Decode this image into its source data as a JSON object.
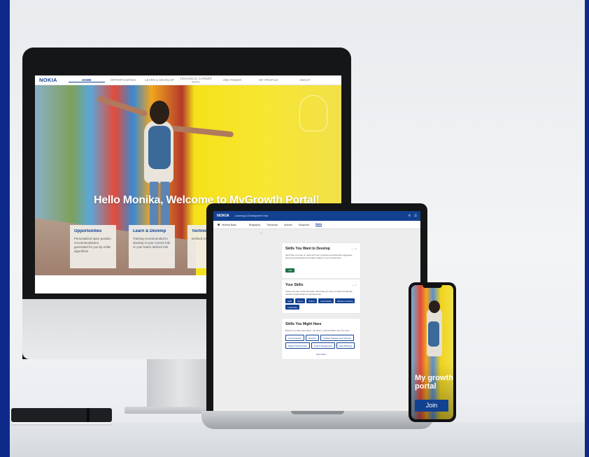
{
  "colors": {
    "frame": "#0d2a8a",
    "brand": "#124191",
    "accent_yellow": "#f5e11a"
  },
  "monitor": {
    "logo": "NOKIA",
    "nav": [
      "HOME",
      "OPPORTUNITIES",
      "LEARN & DEVELOP",
      "TECHNICAL CAREER PATH",
      "JOB FINDER",
      "MY PROFILE",
      "ABOUT"
    ],
    "headline": "Hello Monika, Welcome to MyGrowth Portal!",
    "cards": [
      {
        "title": "Opportunities",
        "text": "Personalized open position recommendations generated for you by AI/ML algorithms"
      },
      {
        "title": "Learn & Develop",
        "text": "Training recommended to develop in your current role or your future desired role"
      },
      {
        "title": "Technical",
        "text": "Defined Growth P"
      }
    ]
  },
  "laptop": {
    "logo": "NOKIA",
    "app_title": "Learning & Development Hub",
    "user": "Monika Bass",
    "tabs": [
      "Biography",
      "Transcript",
      "Actions",
      "Snapshot",
      "Skills"
    ],
    "skills_card": {
      "title": "Skills You Want to Develop",
      "text": "We'll help you stay on track with your progress and advertise suggested learning and development paths related to your preferences.",
      "button": "Add"
    },
    "your_skills": {
      "title": "Your Skills",
      "text": "These are your confirmed skills. We'll help you stay on track and identify relevant opportunities for development.",
      "chips": [
        "Agile",
        "Scrum",
        "Python",
        "Cloud Native",
        "Machine Learning",
        "Leadership"
      ]
    },
    "might_have": {
      "title": "Skills You Might Have",
      "text": "Based on profile information, job history, and feedback from the team.",
      "chips": [
        "Service Design",
        "Analytics",
        "Software Development Lifecycle",
        "Digital Transformation",
        "Project Management",
        "Data Modeling"
      ],
      "view_more": "View More"
    }
  },
  "phone": {
    "title": "My growth portal",
    "join": "Join"
  }
}
